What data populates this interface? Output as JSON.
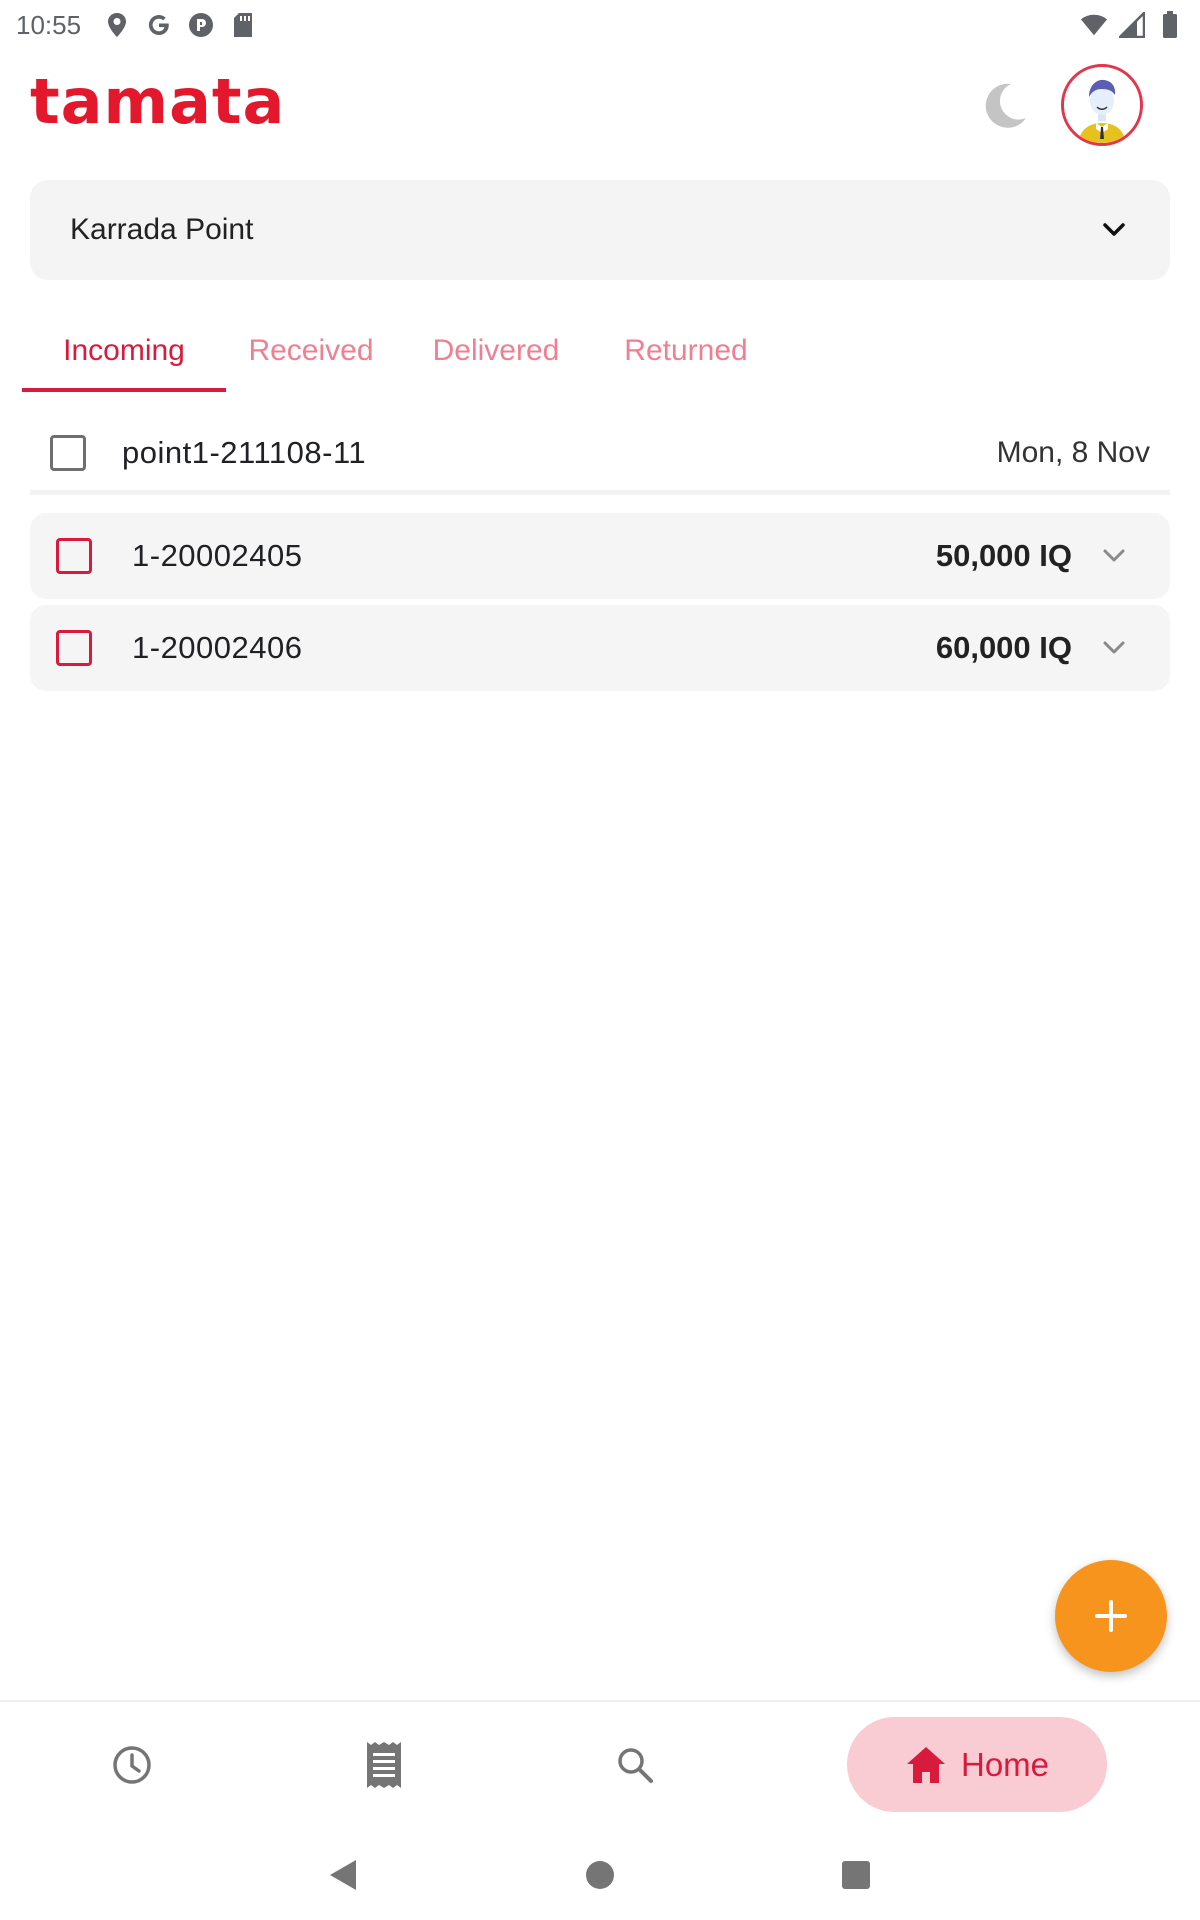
{
  "status_bar": {
    "time": "10:55",
    "left_icons": [
      "location-icon",
      "google-icon",
      "pocket-icon",
      "sd-card-icon"
    ],
    "right_icons": [
      "wifi-icon",
      "signal-icon",
      "battery-icon"
    ]
  },
  "header": {
    "logo_text": "tamata",
    "brand_color": "#e3182d",
    "theme_toggle_icon": "moon-icon",
    "avatar_icon": "user-avatar"
  },
  "point_selector": {
    "value": "Karrada Point",
    "icon": "chevron-down-icon"
  },
  "tabs": [
    {
      "label": "Incoming",
      "active": true
    },
    {
      "label": "Received",
      "active": false
    },
    {
      "label": "Delivered",
      "active": false
    },
    {
      "label": "Returned",
      "active": false
    }
  ],
  "group": {
    "id": "point1-211108-11",
    "date": "Mon, 8 Nov",
    "checked": false
  },
  "orders": [
    {
      "id": "1-20002405",
      "price": "50,000 IQ",
      "checked": false
    },
    {
      "id": "1-20002406",
      "price": "60,000 IQ",
      "checked": false
    }
  ],
  "fab": {
    "icon": "plus-icon",
    "color": "#f7941d"
  },
  "bottom_nav": {
    "items": [
      {
        "name": "history",
        "icon": "clock-icon"
      },
      {
        "name": "orders",
        "icon": "receipt-icon"
      },
      {
        "name": "search",
        "icon": "search-icon"
      },
      {
        "name": "home",
        "icon": "home-icon",
        "label": "Home",
        "active": true
      }
    ]
  },
  "system_nav": {
    "buttons": [
      "back-icon",
      "home-circle-icon",
      "recents-icon"
    ]
  }
}
